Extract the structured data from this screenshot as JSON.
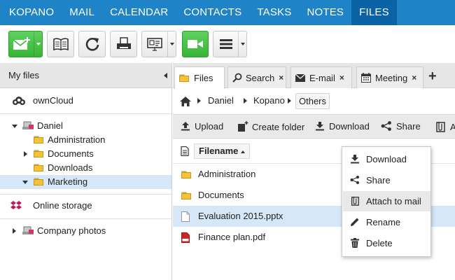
{
  "nav": {
    "items": [
      "KOPANO",
      "MAIL",
      "CALENDAR",
      "CONTACTS",
      "TASKS",
      "NOTES",
      "FILES"
    ],
    "active": "FILES"
  },
  "toolbar": {
    "buttons": [
      "new-mail-icon",
      "address-book-icon",
      "refresh-icon",
      "print-icon",
      "presentation-icon",
      "video-call-icon",
      "menu-icon"
    ]
  },
  "left_panel": {
    "header": "My files",
    "accounts": [
      {
        "label": "ownCloud",
        "icon": "cloud-icon"
      },
      {
        "label": "Online storage",
        "icon": "dropbox-icon"
      }
    ],
    "tree": {
      "root": "Daniel",
      "folders": [
        "Administration",
        "Documents",
        "Downloads",
        "Marketing"
      ],
      "selected": "Marketing"
    },
    "company": "Company photos"
  },
  "tabs": [
    {
      "label": "Files",
      "closable": false
    },
    {
      "label": "Search",
      "closable": true
    },
    {
      "label": "E-mail",
      "closable": true
    },
    {
      "label": "Meeting",
      "closable": true
    }
  ],
  "breadcrumb": [
    "Daniel",
    "Kopano",
    "Others"
  ],
  "actions": {
    "upload": "Upload",
    "create_folder": "Create folder",
    "download": "Download",
    "share": "Share",
    "attach_partial": "A"
  },
  "list": {
    "column": "Filename",
    "rows": [
      {
        "name": "Administration",
        "type": "folder"
      },
      {
        "name": "Documents",
        "type": "folder"
      },
      {
        "name": "Evaluation 2015.pptx",
        "type": "file"
      },
      {
        "name": "Finance plan.pdf",
        "type": "pdf"
      }
    ],
    "selected": "Evaluation 2015.pptx"
  },
  "context_menu": {
    "items": [
      "Download",
      "Share",
      "Attach to mail",
      "Rename",
      "Delete"
    ],
    "hovered": "Attach to mail"
  },
  "colors": {
    "nav_bg": "#1f83c7",
    "nav_active": "#0b63a6",
    "selection": "#d6e7f7",
    "green": "#37b537"
  }
}
